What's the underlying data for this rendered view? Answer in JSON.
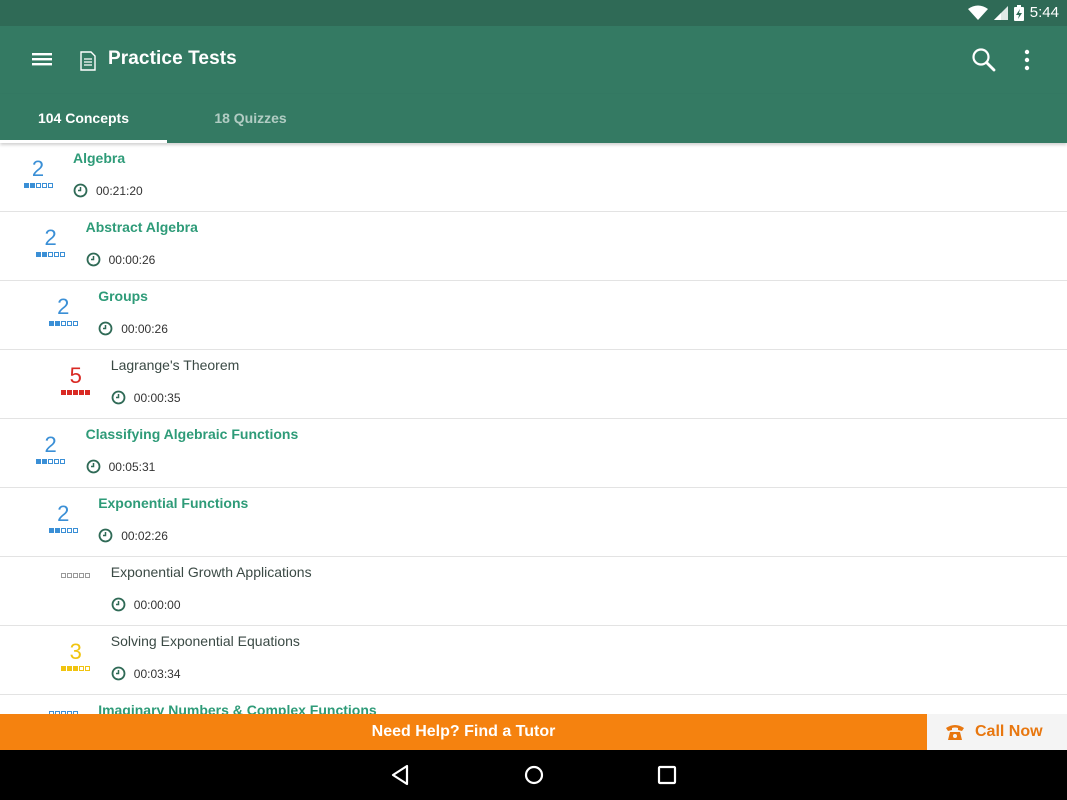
{
  "status_bar": {
    "time": "5:44",
    "icons": [
      "wifi-icon",
      "signal-icon",
      "battery-charging-icon"
    ]
  },
  "app_bar": {
    "title": "Practice Tests",
    "icons": [
      "menu-icon",
      "document-icon",
      "search-icon",
      "more-vert-icon"
    ]
  },
  "tabs": [
    {
      "label": "104 Concepts",
      "selected": true
    },
    {
      "label": "18 Quizzes",
      "selected": false
    }
  ],
  "concepts": [
    {
      "name": "Algebra",
      "time": "00:21:20",
      "score": "2",
      "filled": 2,
      "style": "bold",
      "color": "#3a8fd6"
    },
    {
      "name": "Abstract Algebra",
      "time": "00:00:26",
      "score": "2",
      "filled": 2,
      "style": "bold",
      "color": "#3a8fd6"
    },
    {
      "name": "Groups",
      "time": "00:00:26",
      "score": "2",
      "filled": 2,
      "style": "bold",
      "color": "#3a8fd6"
    },
    {
      "name": "Lagrange's Theorem",
      "time": "00:00:35",
      "score": "5",
      "filled": 5,
      "style": "plain",
      "color": "#d92a24"
    },
    {
      "name": "Classifying Algebraic Functions",
      "time": "00:05:31",
      "score": "2",
      "filled": 2,
      "style": "bold",
      "color": "#3a8fd6"
    },
    {
      "name": "Exponential Functions",
      "time": "00:02:26",
      "score": "2",
      "filled": 2,
      "style": "bold",
      "color": "#3a8fd6"
    },
    {
      "name": "Exponential Growth Applications",
      "time": "00:00:00",
      "score": "",
      "filled": 0,
      "style": "plain",
      "color": "#9a9a9a"
    },
    {
      "name": "Solving Exponential Equations",
      "time": "00:03:34",
      "score": "3",
      "filled": 3,
      "style": "plain",
      "color": "#f1c40f"
    },
    {
      "name": "Imaginary Numbers & Complex Functions",
      "time": "",
      "score": "",
      "filled": 0,
      "style": "bold",
      "color": "#3a8fd6"
    }
  ],
  "help_bar": {
    "find_tutor": "Need Help? Find a Tutor",
    "call_now": "Call Now",
    "icons": [
      "phone-icon"
    ]
  },
  "nav_bar": {
    "icons": [
      "back-icon",
      "home-icon",
      "recents-icon"
    ]
  },
  "colors": {
    "primary": "#347a63",
    "primary_dark": "#2f6a56",
    "accent_green": "#2e9b78",
    "orange": "#f5820f"
  }
}
